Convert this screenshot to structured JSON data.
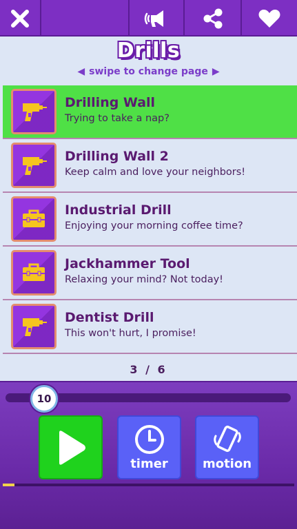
{
  "topbar": {
    "close_icon": "close-icon",
    "sound_icon": "megaphone-icon",
    "share_icon": "share-icon",
    "heart_icon": "heart-icon"
  },
  "header": {
    "title": "Drills",
    "subtitle": "swipe to change page"
  },
  "list": [
    {
      "title": "Drilling Wall",
      "subtitle": "Trying to take a nap?",
      "icon": "drill-icon",
      "active": true
    },
    {
      "title": "Drilling Wall 2",
      "subtitle": "Keep calm and love your neighbors!",
      "icon": "drill-icon",
      "active": false
    },
    {
      "title": "Industrial Drill",
      "subtitle": "Enjoying your morning coffee time?",
      "icon": "toolbox-icon",
      "active": false
    },
    {
      "title": "Jackhammer Tool",
      "subtitle": "Relaxing your mind? Not today!",
      "icon": "toolbox-icon",
      "active": false
    },
    {
      "title": "Dentist Drill",
      "subtitle": "This won't hurt, I promise!",
      "icon": "drill-icon",
      "active": false
    }
  ],
  "pager": "3 / 6",
  "controls": {
    "slider_value": "10",
    "slider_fraction": 0.15,
    "play_icon": "play-icon",
    "timer_label": "timer",
    "motion_label": "motion",
    "progress_fraction": 0.01
  },
  "colors": {
    "brand": "#7d2fc3",
    "active_row": "#4fe046",
    "play_button": "#1fd21d",
    "secondary_button": "#5a61f7"
  }
}
